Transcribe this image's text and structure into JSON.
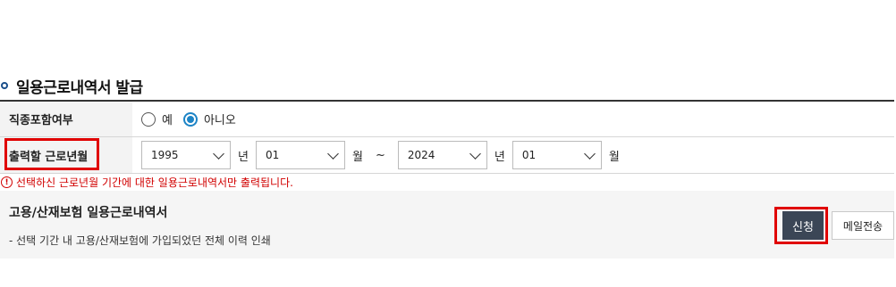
{
  "section": {
    "title": "일용근로내역서 발급"
  },
  "form": {
    "row1": {
      "label": "직종포함여부",
      "options": [
        {
          "label": "예",
          "checked": false
        },
        {
          "label": "아니오",
          "checked": true
        }
      ]
    },
    "row2": {
      "label": "출력할 근로년월",
      "start_year": "1995",
      "start_year_unit": "년",
      "start_month": "01",
      "start_month_unit": "월",
      "separator": "~",
      "end_year": "2024",
      "end_year_unit": "년",
      "end_month": "01",
      "end_month_unit": "월"
    }
  },
  "notice": {
    "icon": "!",
    "text": "선택하신 근로년월 기간에 대한 일용근로내역서만 출력됩니다."
  },
  "result": {
    "title": "고용/산재보험 일용근로내역서",
    "description": "- 선택 기간 내 고용/산재보험에 가입되었던 전체 이력 인쇄",
    "apply_label": "신청",
    "mail_label": "메일전송"
  },
  "colors": {
    "accent": "#1d84c6",
    "highlight": "#e00000",
    "notice": "#d10000",
    "apply_button": "#3b4656"
  }
}
